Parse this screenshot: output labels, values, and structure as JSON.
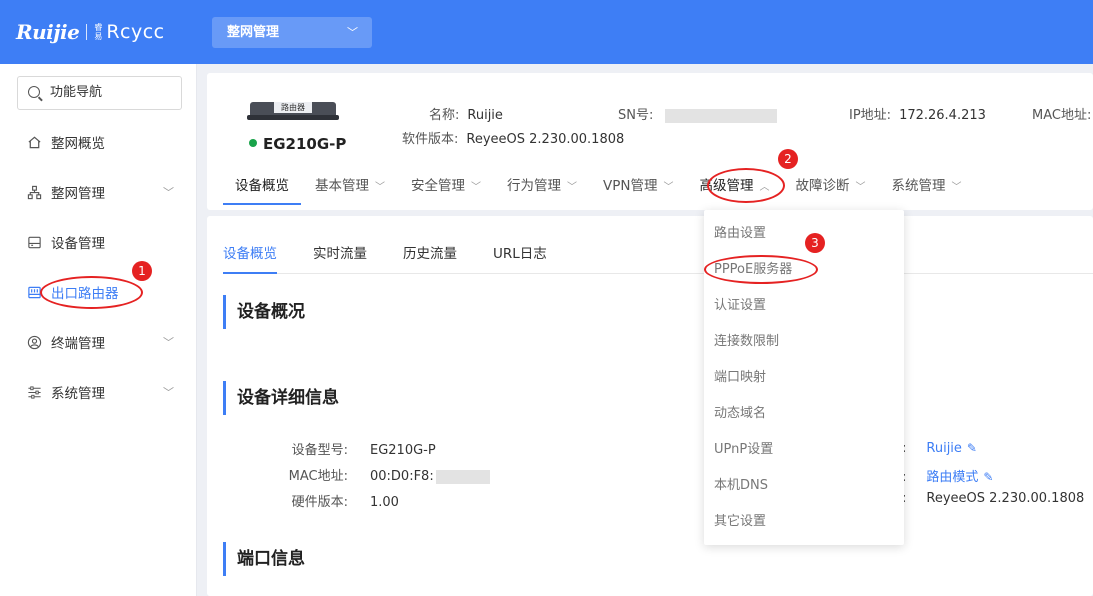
{
  "header": {
    "logo_brand": "Ruijie",
    "logo_small": "睿易",
    "logo_product": "Rcycc",
    "scope_select": "整网管理"
  },
  "sidebar": {
    "search_label": "功能导航",
    "items": [
      {
        "label": "整网概览",
        "icon": "home-icon",
        "has_children": false,
        "active": false
      },
      {
        "label": "整网管理",
        "icon": "topology-icon",
        "has_children": true,
        "active": false
      },
      {
        "label": "设备管理",
        "icon": "device-icon",
        "has_children": false,
        "active": false
      },
      {
        "label": "出口路由器",
        "icon": "router-icon",
        "has_children": false,
        "active": true
      },
      {
        "label": "终端管理",
        "icon": "user-icon",
        "has_children": true,
        "active": false
      },
      {
        "label": "系统管理",
        "icon": "settings-sliders-icon",
        "has_children": true,
        "active": false
      }
    ]
  },
  "device": {
    "image_label": "路由器",
    "model": "EG210G-P",
    "status_color": "#19a34a",
    "name_label": "名称:",
    "name_value": "Ruijie",
    "sn_label": "SN号:",
    "software_label": "软件版本:",
    "software_value": "ReyeeOS 2.230.00.1808",
    "ip_label": "IP地址:",
    "ip_value": "172.26.4.213",
    "mac_label": "MAC地址:"
  },
  "tabs": [
    {
      "label": "设备概览",
      "dropdown": false
    },
    {
      "label": "基本管理",
      "dropdown": true
    },
    {
      "label": "安全管理",
      "dropdown": true
    },
    {
      "label": "行为管理",
      "dropdown": true
    },
    {
      "label": "VPN管理",
      "dropdown": true
    },
    {
      "label": "高级管理",
      "dropdown": true
    },
    {
      "label": "故障诊断",
      "dropdown": true
    },
    {
      "label": "系统管理",
      "dropdown": true
    }
  ],
  "subtabs": [
    "设备概览",
    "实时流量",
    "历史流量",
    "URL日志"
  ],
  "sections": {
    "overview": "设备概况",
    "detail": "设备详细信息",
    "ports": "端口信息"
  },
  "details_left": [
    {
      "key": "设备型号:",
      "value": "EG210G-P"
    },
    {
      "key": "MAC地址:",
      "value": "00:D0:F8:"
    },
    {
      "key": "硬件版本:",
      "value": "1.00"
    }
  ],
  "details_right": [
    {
      "value": "Ruijie",
      "editable": true
    },
    {
      "value": "路由模式",
      "editable": true
    },
    {
      "value": "ReyeeOS 2.230.00.1808",
      "editable": false
    }
  ],
  "dropdown_menu": [
    "路由设置",
    "PPPoE服务器",
    "认证设置",
    "连接数限制",
    "端口映射",
    "动态域名",
    "UPnP设置",
    "本机DNS",
    "其它设置"
  ],
  "annotations": {
    "badge1": "1",
    "badge2": "2",
    "badge3": "3",
    "color": "#e52222"
  },
  "colors": {
    "primary": "#3e7ef5",
    "status_online": "#19a34a"
  }
}
